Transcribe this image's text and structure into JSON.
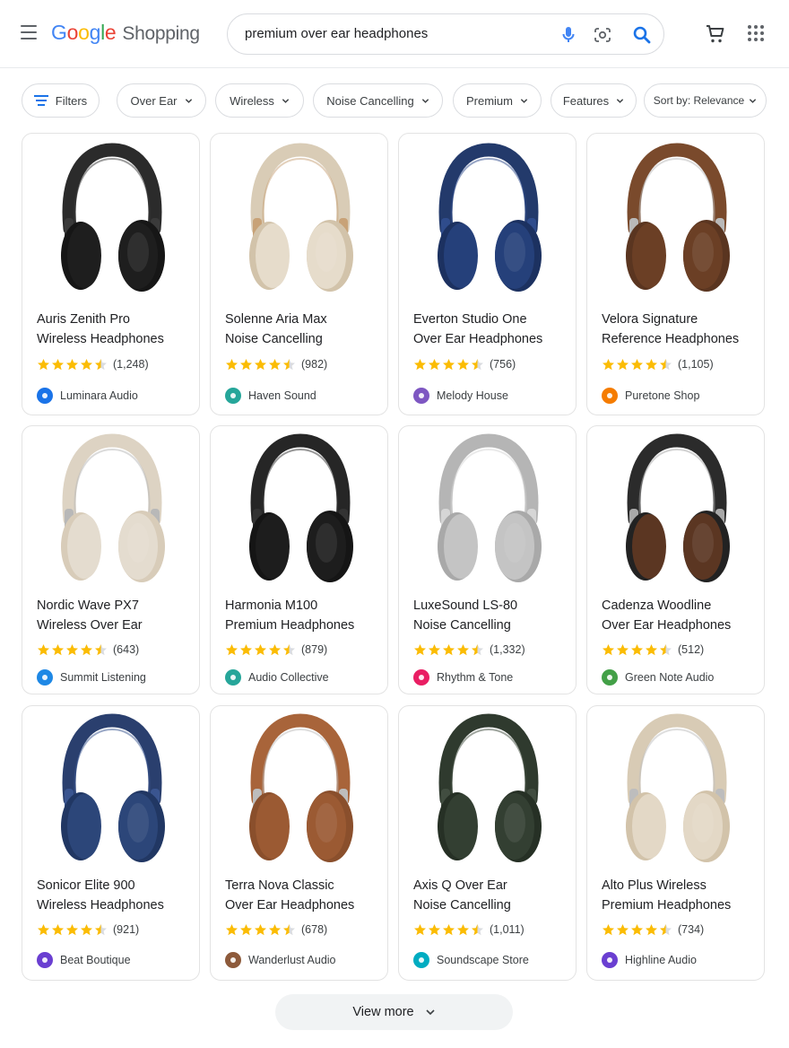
{
  "header": {
    "logo": {
      "letters": [
        "G",
        "o",
        "o",
        "g",
        "l",
        "e"
      ],
      "product": "Shopping"
    },
    "search_query": "premium over ear headphones"
  },
  "filters": [
    {
      "label": "Filters",
      "icon": "filter-icon"
    },
    {
      "label": "Over Ear"
    },
    {
      "label": "Wireless"
    },
    {
      "label": "Noise Cancelling"
    },
    {
      "label": "Premium"
    },
    {
      "label": "Features"
    },
    {
      "label": "Sort by: Relevance"
    }
  ],
  "products": [
    {
      "title_line1": "Auris Zenith Pro",
      "title_line2": "Wireless Headphones",
      "rating": 4.5,
      "reviews": "(1,248)",
      "store": "Luminara Audio",
      "store_color": "#1a73e8",
      "color": {
        "band": "#2b2b2b",
        "cup": "#1e1e1e",
        "pad": "#161616",
        "accent": "#3a3a3a"
      }
    },
    {
      "title_line1": "Solenne Aria Max",
      "title_line2": "Noise Cancelling",
      "rating": 4.5,
      "reviews": "(982)",
      "store": "Haven Sound",
      "store_color": "#26a69a",
      "color": {
        "band": "#d9ccb6",
        "cup": "#e6dccb",
        "pad": "#d2c3aa",
        "accent": "#c8a277"
      }
    },
    {
      "title_line1": "Everton Studio One",
      "title_line2": "Over Ear Headphones",
      "rating": 4.5,
      "reviews": "(756)",
      "store": "Melody House",
      "store_color": "#7e57c2",
      "color": {
        "band": "#233a6b",
        "cup": "#25407a",
        "pad": "#1c3160",
        "accent": "#2f4c8c"
      }
    },
    {
      "title_line1": "Velora Signature",
      "title_line2": "Reference Headphones",
      "rating": 4.5,
      "reviews": "(1,105)",
      "store": "Puretone Shop",
      "store_color": "#f57c00",
      "color": {
        "band": "#7a4a2c",
        "cup": "#6b3f25",
        "pad": "#5a3520",
        "accent": "#b9b9b9"
      }
    },
    {
      "title_line1": "Nordic Wave PX7",
      "title_line2": "Wireless Over Ear",
      "rating": 4.5,
      "reviews": "(643)",
      "store": "Summit Listening",
      "store_color": "#1e88e5",
      "color": {
        "band": "#ddd3c3",
        "cup": "#e4dccf",
        "pad": "#d8ccb9",
        "accent": "#b8b8b8"
      }
    },
    {
      "title_line1": "Harmonia M100",
      "title_line2": "Premium Headphones",
      "rating": 4.5,
      "reviews": "(879)",
      "store": "Audio Collective",
      "store_color": "#26a69a",
      "color": {
        "band": "#262626",
        "cup": "#1d1d1d",
        "pad": "#151515",
        "accent": "#333333"
      }
    },
    {
      "title_line1": "LuxeSound LS-80",
      "title_line2": "Noise Cancelling",
      "rating": 4.5,
      "reviews": "(1,332)",
      "store": "Rhythm & Tone",
      "store_color": "#e91e63",
      "color": {
        "band": "#b5b5b5",
        "cup": "#c4c4c4",
        "pad": "#a9a9a9",
        "accent": "#d6d6d6"
      }
    },
    {
      "title_line1": "Cadenza Woodline",
      "title_line2": "Over Ear Headphones",
      "rating": 4.5,
      "reviews": "(512)",
      "store": "Green Note Audio",
      "store_color": "#43a047",
      "color": {
        "band": "#2b2b2b",
        "cup": "#5b3622",
        "pad": "#222222",
        "accent": "#a8a8a8"
      }
    },
    {
      "title_line1": "Sonicor Elite 900",
      "title_line2": "Wireless Headphones",
      "rating": 4.5,
      "reviews": "(921)",
      "store": "Beat Boutique",
      "store_color": "#6a3fd1",
      "color": {
        "band": "#2a3f6e",
        "cup": "#2c4679",
        "pad": "#213763",
        "accent": "#3a5590"
      }
    },
    {
      "title_line1": "Terra Nova Classic",
      "title_line2": "Over Ear Headphones",
      "rating": 4.5,
      "reviews": "(678)",
      "store": "Wanderlust Audio",
      "store_color": "#8d5a3b",
      "color": {
        "band": "#a8643a",
        "cup": "#9b5a33",
        "pad": "#8a4f2c",
        "accent": "#bdbdbd"
      }
    },
    {
      "title_line1": "Axis Q Over Ear",
      "title_line2": "Noise Cancelling",
      "rating": 4.5,
      "reviews": "(1,011)",
      "store": "Soundscape Store",
      "store_color": "#00acc1",
      "color": {
        "band": "#2f3a2e",
        "cup": "#333f32",
        "pad": "#263025",
        "accent": "#414d40"
      }
    },
    {
      "title_line1": "Alto Plus Wireless",
      "title_line2": "Premium Headphones",
      "rating": 4.5,
      "reviews": "(734)",
      "store": "Highline Audio",
      "store_color": "#6a3fd1",
      "color": {
        "band": "#d8cbb5",
        "cup": "#e3d8c6",
        "pad": "#d2c3aa",
        "accent": "#bdbdbd"
      }
    }
  ],
  "view_more": "View more"
}
